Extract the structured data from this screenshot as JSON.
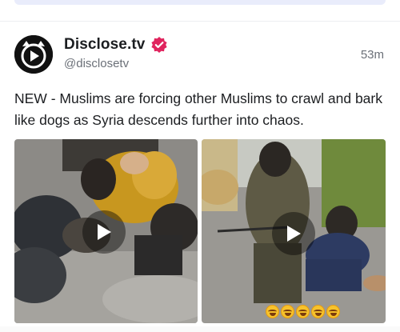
{
  "post": {
    "author_name": "Disclose.tv",
    "author_handle": "@disclosetv",
    "timestamp": "53m",
    "verified": true,
    "text": "NEW - Muslims are forcing other Muslims to crawl and bark like dogs as Syria descends further into chaos."
  },
  "media": [
    {
      "type": "video",
      "icon": "play-icon"
    },
    {
      "type": "video",
      "icon": "play-icon",
      "overlay_emoji": [
        "laughing-emoji",
        "laughing-emoji",
        "laughing-emoji",
        "laughing-emoji",
        "laughing-emoji"
      ]
    }
  ],
  "colors": {
    "verified_badge": "#e0245e",
    "text": "#1c1e21",
    "secondary_text": "#6b7078",
    "avatar_bg": "#111111"
  }
}
